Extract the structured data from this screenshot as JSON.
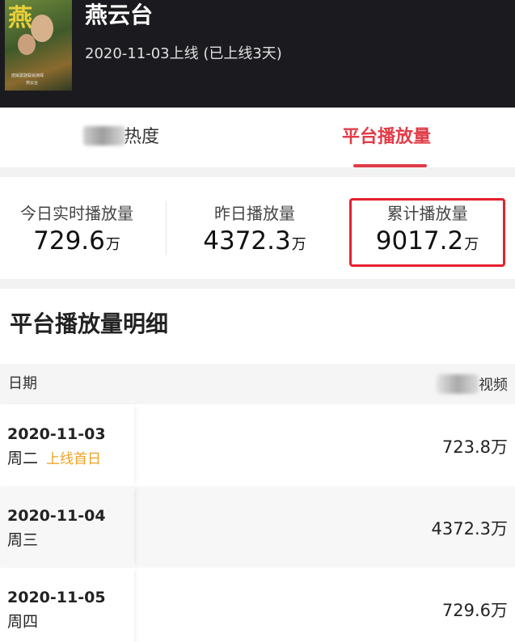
{
  "header": {
    "title": "燕云台",
    "subtitle": "2020-11-03上线 (已上线3天)",
    "poster": {
      "glyph": "燕",
      "caption_line1": "唐嫣窦骁联袂演绎",
      "caption_line2": "燕云台"
    }
  },
  "tabs": [
    {
      "label": "热度",
      "active": false
    },
    {
      "label": "平台播放量",
      "active": true
    }
  ],
  "colors": {
    "accent": "#e03c48",
    "highlight_box": "#e5202e",
    "badge": "#f0a020",
    "header_bg": "#1b1b1f"
  },
  "stats": [
    {
      "label": "今日实时播放量",
      "value": "729.6",
      "unit": "万"
    },
    {
      "label": "昨日播放量",
      "value": "4372.3",
      "unit": "万"
    },
    {
      "label": "累计播放量",
      "value": "9017.2",
      "unit": "万",
      "highlighted": true
    }
  ],
  "detail": {
    "title": "平台播放量明细",
    "columns": {
      "date": "日期",
      "platform": "视频"
    },
    "rows": [
      {
        "date": "2020-11-03",
        "weekday": "周二",
        "badge": "上线首日",
        "value": "723.8万"
      },
      {
        "date": "2020-11-04",
        "weekday": "周三",
        "badge": "",
        "value": "4372.3万"
      },
      {
        "date": "2020-11-05",
        "weekday": "周四",
        "badge": "",
        "value": "729.6万"
      }
    ]
  }
}
